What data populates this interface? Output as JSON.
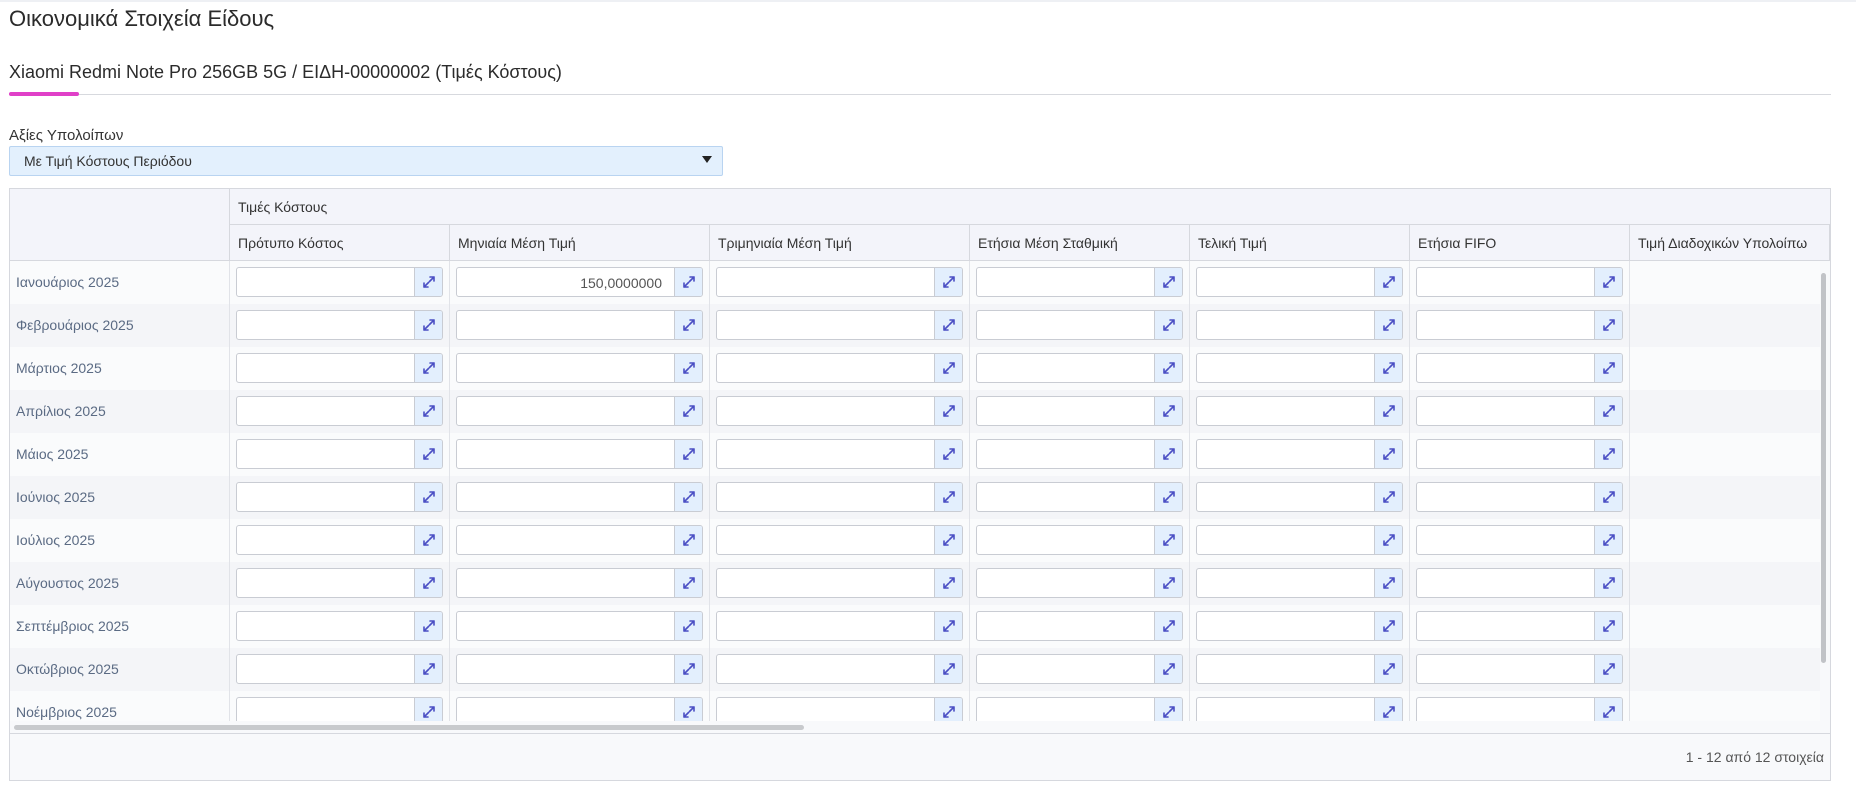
{
  "page": {
    "title": "Οικονομικά Στοιχεία Είδους"
  },
  "tab": {
    "label": "Xiaomi Redmi Note Pro 256GB 5G / ΕΙΔΗ-00000002 (Τιμές Κόστους)"
  },
  "balance": {
    "label": "Αξίες Υπολοίπων",
    "selected": "Με Τιμή Κόστους Περιόδου"
  },
  "grid": {
    "group_header": "Τιμές Κόστους",
    "columns": [
      "Πρότυπο Κόστος",
      "Μηνιαία Μέση Τιμή",
      "Τριμηνιαία Μέση Τιμή",
      "Ετήσια Μέση Σταθμική",
      "Τελική Τιμή",
      "Ετήσια FIFO",
      "Τιμή Διαδοχικών Υπολοίπω"
    ],
    "rows": [
      {
        "label": "Ιανουάριος 2025",
        "values": [
          "",
          "150,0000000",
          "",
          "",
          "",
          ""
        ]
      },
      {
        "label": "Φεβρουάριος 2025",
        "values": [
          "",
          "",
          "",
          "",
          "",
          ""
        ]
      },
      {
        "label": "Μάρτιος 2025",
        "values": [
          "",
          "",
          "",
          "",
          "",
          ""
        ]
      },
      {
        "label": "Απρίλιος 2025",
        "values": [
          "",
          "",
          "",
          "",
          "",
          ""
        ]
      },
      {
        "label": "Μάιος 2025",
        "values": [
          "",
          "",
          "",
          "",
          "",
          ""
        ]
      },
      {
        "label": "Ιούνιος 2025",
        "values": [
          "",
          "",
          "",
          "",
          "",
          ""
        ]
      },
      {
        "label": "Ιούλιος 2025",
        "values": [
          "",
          "",
          "",
          "",
          "",
          ""
        ]
      },
      {
        "label": "Αύγουστος 2025",
        "values": [
          "",
          "",
          "",
          "",
          "",
          ""
        ]
      },
      {
        "label": "Σεπτέμβριος 2025",
        "values": [
          "",
          "",
          "",
          "",
          "",
          ""
        ]
      },
      {
        "label": "Οκτώβριος 2025",
        "values": [
          "",
          "",
          "",
          "",
          "",
          ""
        ]
      },
      {
        "label": "Νοέμβριος 2025",
        "values": [
          "",
          "",
          "",
          "",
          "",
          ""
        ]
      }
    ],
    "pager": "1 - 12 από 12 στοιχεία"
  },
  "icons": {
    "expand": "expand-icon",
    "caret": "chevron-down-icon"
  },
  "colors": {
    "accent": "#e040c8",
    "select_bg": "#e3f0fd",
    "icon": "#4b4fc4"
  }
}
